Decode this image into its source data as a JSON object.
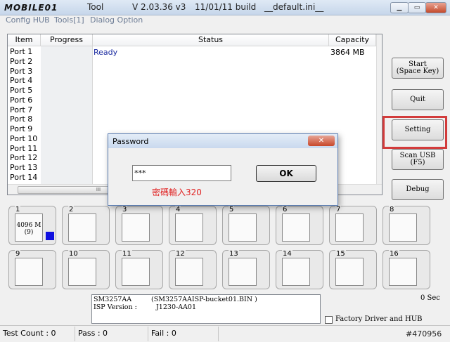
{
  "window": {
    "logo": "MOBILE01",
    "title_tool": "Tool",
    "version": "V 2.03.36  v3",
    "build": "11/01/11  build",
    "ini": "__default.ini__"
  },
  "menu": [
    "Config HUB",
    "Tools[1]",
    "Dialog Option"
  ],
  "table": {
    "columns": [
      "Item",
      "Progress",
      "Status",
      "Capacity"
    ],
    "ports": [
      "Port 1",
      "Port 2",
      "Port 3",
      "Port 4",
      "Port 5",
      "Port 6",
      "Port 7",
      "Port 8",
      "Port 9",
      "Port 10",
      "Port 11",
      "Port 12",
      "Port 13",
      "Port 14"
    ],
    "status": "Ready",
    "capacity": "3864 MB",
    "hscroll_label": "III"
  },
  "side_buttons": {
    "start": "Start\n(Space Key)",
    "quit": "Quit",
    "setting": "Setting",
    "scan": "Scan USB\n(F5)",
    "debug": "Debug"
  },
  "slots": {
    "labels": [
      "1",
      "2",
      "3",
      "4",
      "5",
      "6",
      "7",
      "8",
      "9",
      "10",
      "11",
      "12",
      "13",
      "14",
      "15",
      "16"
    ],
    "slot1_size": "4096 M",
    "slot1_count": "(9)"
  },
  "info": {
    "line1_left": "SM3257AA",
    "line1_right": "(SM3257AAISP-bucket01.BIN )",
    "line2_left": "ISP Version :",
    "line2_right": "J1230-AA01"
  },
  "seconds": "0 Sec",
  "factory_label": "Factory Driver and HUB",
  "statusbar": {
    "test": "Test Count : 0",
    "pass": "Pass : 0",
    "fail": "Fail : 0"
  },
  "watermark": "#470956",
  "dialog": {
    "title": "Password",
    "close": "✕",
    "input_value": "***",
    "ok": "OK",
    "hint": "密碼輸入320"
  },
  "colors": {
    "highlight": "#d23b3b",
    "indicator": "#1010e0",
    "hint": "#e02020"
  }
}
